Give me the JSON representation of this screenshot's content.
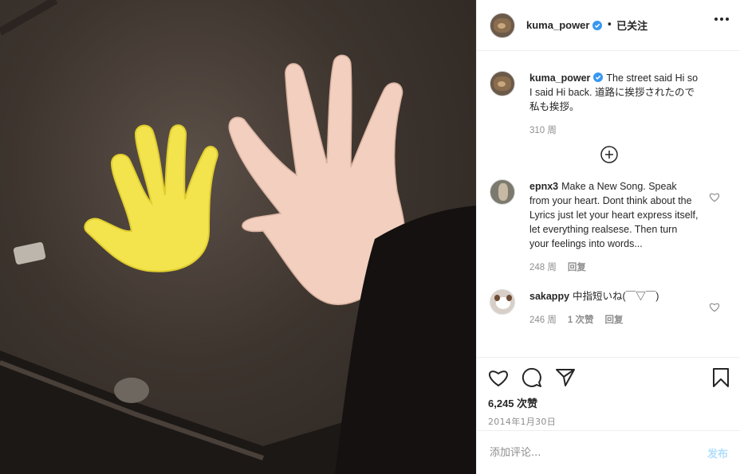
{
  "post": {
    "author": "kuma_power",
    "follow_separator": "•",
    "follow_status": "已关注",
    "colors": {
      "verified": "#3897f0",
      "post_button": "#b2dffc",
      "muted": "#8e8e8e"
    }
  },
  "comments": [
    {
      "user": "kuma_power",
      "text": "The street said Hi so I said Hi back. 道路に挨拶されたので私も挨拶。",
      "time": "310 周",
      "is_caption": true
    },
    {
      "user": "epnx3",
      "text": "Make a New Song. Speak from your heart. Dont think about the Lyrics just let your heart express itself, let everything realsese. Then turn your feelings into words...",
      "time": "248 周",
      "reply": "回复"
    },
    {
      "user": "sakappy",
      "text": "中指短いね(￣▽￣)",
      "time": "246 周",
      "likes": "1 次赞",
      "reply": "回复"
    }
  ],
  "actions": {
    "likes_count": "6,245 次赞",
    "date": "2014年1月30日"
  },
  "add_comment": {
    "placeholder": "添加评论...",
    "post_label": "发布"
  },
  "icons": [
    "more-icon",
    "verified-icon",
    "load-more-icon",
    "heart-icon",
    "comment-icon",
    "share-icon",
    "bookmark-icon"
  ]
}
